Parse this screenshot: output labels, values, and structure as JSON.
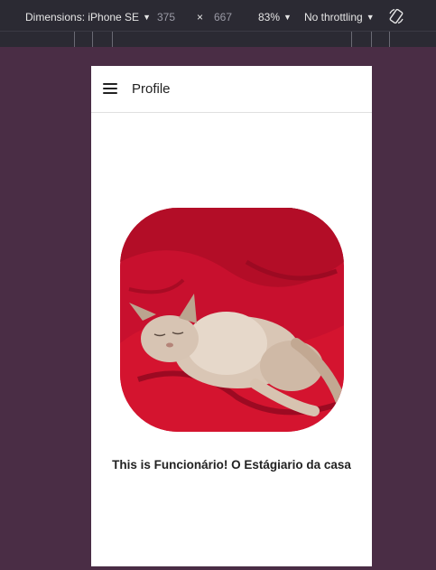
{
  "devtools": {
    "dimensions_label": "Dimensions: iPhone SE",
    "width": "375",
    "times": "×",
    "height": "667",
    "zoom": "83%",
    "throttling": "No throttling",
    "rotate_icon": "rotate-device-icon"
  },
  "app": {
    "menu_icon": "hamburger-menu-icon",
    "title": "Profile",
    "caption": "This is Funcionário! O Estágiario da casa"
  },
  "colors": {
    "background": "#4a2d45",
    "toolbar": "#2b2a33",
    "blanket_red": "#c8102e",
    "cat_fur": "#d9c6b5"
  }
}
